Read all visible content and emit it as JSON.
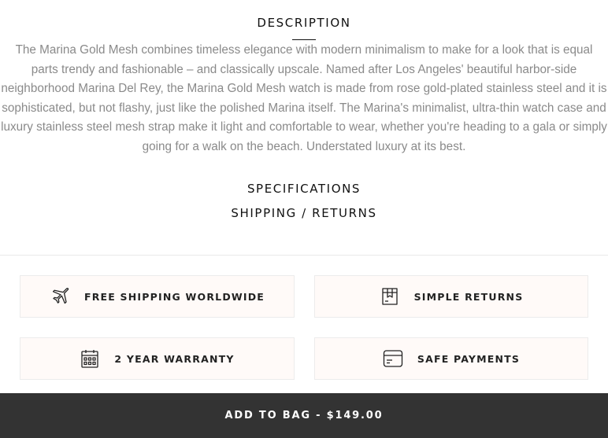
{
  "description": {
    "title": "DESCRIPTION",
    "body": "The Marina Gold Mesh combines timeless elegance with modern minimalism to make for a look that is equal parts trendy and fashionable – and classically upscale. Named after Los Angeles' beautiful harbor-side neighborhood Marina Del Rey, the Marina Gold Mesh watch is made from rose gold-plated stainless steel and it is sophisticated, but not flashy, just like the polished Marina itself. The Marina's minimalist, ultra-thin watch case and luxury stainless steel mesh strap make it light and comfortable to wear, whether you're heading to a gala or simply going for a walk on the beach. Understated luxury at its best."
  },
  "accordion": {
    "specifications": "SPECIFICATIONS",
    "shipping_returns": "SHIPPING / RETURNS"
  },
  "features": [
    {
      "label": "FREE SHIPPING WORLDWIDE",
      "icon": "airplane-icon"
    },
    {
      "label": "SIMPLE RETURNS",
      "icon": "package-icon"
    },
    {
      "label": "2 YEAR WARRANTY",
      "icon": "calendar-icon"
    },
    {
      "label": "SAFE PAYMENTS",
      "icon": "credit-card-icon"
    }
  ],
  "cart": {
    "add_to_bag_label": "ADD TO BAG - $149.00"
  },
  "colors": {
    "bar_background": "#333333",
    "feature_background": "#fffaf8",
    "body_text": "#8a8a8a"
  }
}
